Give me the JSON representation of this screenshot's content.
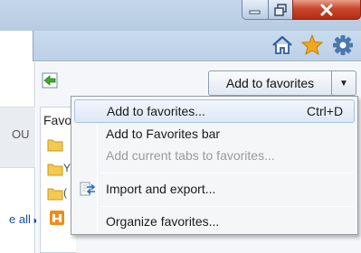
{
  "window_controls": {
    "minimize": "minimize-icon",
    "maximize": "restore-icon",
    "close": "close-icon"
  },
  "toolbar_icons": [
    "home-icon",
    "star-icon",
    "gear-icon"
  ],
  "left_page": {
    "fragment_text": "OU",
    "see_all_link": "e all"
  },
  "favorites": {
    "add_button_label": "Add to favorites",
    "panel_tab_label": "Favo",
    "folder_fragments": [
      "",
      "Y",
      "("
    ]
  },
  "menu": {
    "items": [
      {
        "label": "Add to favorites...",
        "shortcut": "Ctrl+D",
        "state": "highlighted"
      },
      {
        "label": "Add to Favorites bar",
        "state": "normal"
      },
      {
        "label": "Add current tabs to favorites...",
        "state": "disabled"
      },
      {
        "label": "Import and export...",
        "state": "normal",
        "icon": "import-export-icon"
      },
      {
        "label": "Organize favorites...",
        "state": "normal"
      }
    ]
  },
  "colors": {
    "chrome": "#bcd0e6",
    "close_red": "#c9462c",
    "highlight": "#dde8f6",
    "star": "#f2a81d",
    "folder": "#f3c94f"
  }
}
